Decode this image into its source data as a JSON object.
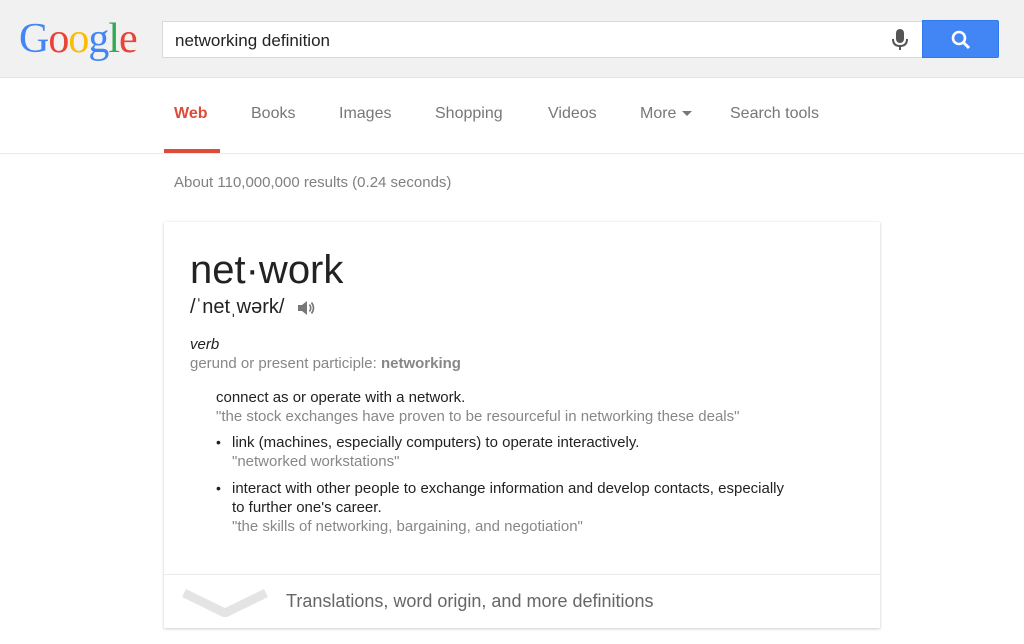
{
  "logo": {
    "letters": [
      "G",
      "o",
      "o",
      "g",
      "l",
      "e"
    ]
  },
  "search": {
    "query": "networking definition"
  },
  "tabs": [
    {
      "label": "Web"
    },
    {
      "label": "Books"
    },
    {
      "label": "Images"
    },
    {
      "label": "Shopping"
    },
    {
      "label": "Videos"
    },
    {
      "label": "More"
    },
    {
      "label": "Search tools"
    }
  ],
  "stats": "About 110,000,000 results (0.24 seconds)",
  "definition": {
    "word": "net·work",
    "phonetic": "/ˈnetˌwərk/",
    "part_of_speech": "verb",
    "gerund_label": "gerund or present participle: ",
    "gerund_value": "networking",
    "senses": [
      {
        "text": "connect as or operate with a network.",
        "example": "\"the stock exchanges have proven to be resourceful in networking these deals\""
      },
      {
        "text": "link (machines, especially computers) to operate interactively.",
        "example": "\"networked workstations\""
      },
      {
        "text_line1": "interact with other people to exchange information and develop contacts, especially",
        "text_line2": "to further one's career.",
        "example": "\"the skills of networking, bargaining, and negotiation\""
      }
    ],
    "bullet": "•",
    "more_label": "Translations, word origin, and more definitions"
  },
  "colors": {
    "accent_red": "#dd4b39",
    "search_blue": "#4285f4"
  }
}
